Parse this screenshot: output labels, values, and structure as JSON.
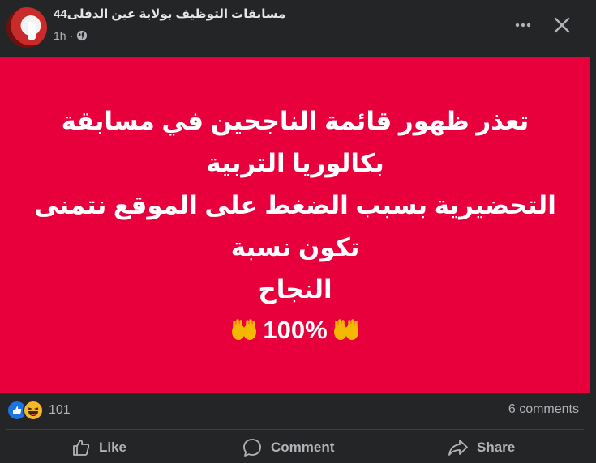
{
  "header": {
    "title": "مسابقات التوظيف بولاية عين الدفلى44",
    "time": "1h",
    "more_icon": "more-horizontal-icon",
    "close_icon": "close-icon"
  },
  "post": {
    "background": "#e8003d",
    "lines": [
      "تعذر ظهور قائمة الناجحين في مسابقة بكالوريا التربية",
      "التحضيرية بسبب الضغط على الموقع نتمنى تكون نسبة",
      "النجاح"
    ],
    "percent": "100%"
  },
  "reactions": {
    "count": "101",
    "comments": "6 comments"
  },
  "actions": {
    "like": "Like",
    "comment": "Comment",
    "share": "Share"
  }
}
